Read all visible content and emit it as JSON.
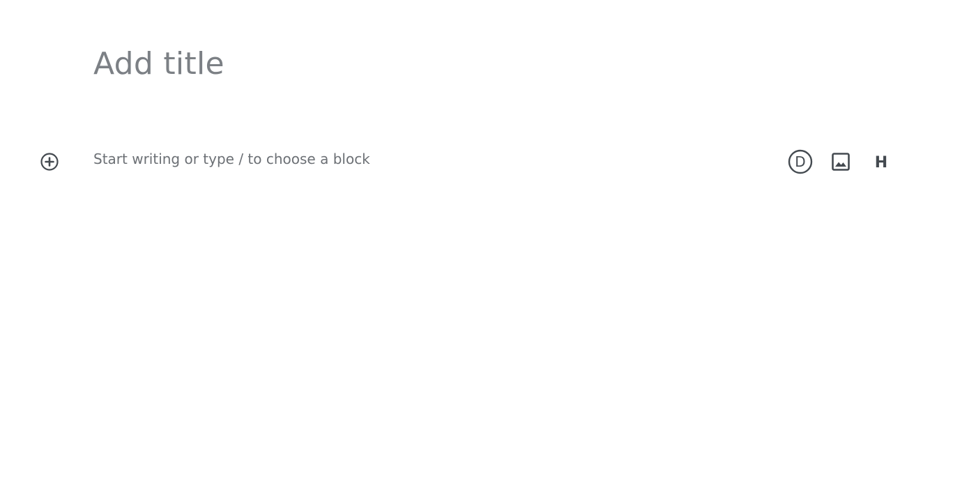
{
  "editor": {
    "title_placeholder": "Add title",
    "block_placeholder": "Start writing or type / to choose a block"
  },
  "inserter": {
    "icon": "plus-circle-icon"
  },
  "quick_blocks": [
    {
      "icon": "divi-icon",
      "glyph": "D"
    },
    {
      "icon": "image-icon"
    },
    {
      "icon": "heading-icon",
      "glyph": "H"
    }
  ],
  "colors": {
    "placeholder_text": "#7c8085",
    "icon": "#444a50",
    "background": "#ffffff"
  }
}
